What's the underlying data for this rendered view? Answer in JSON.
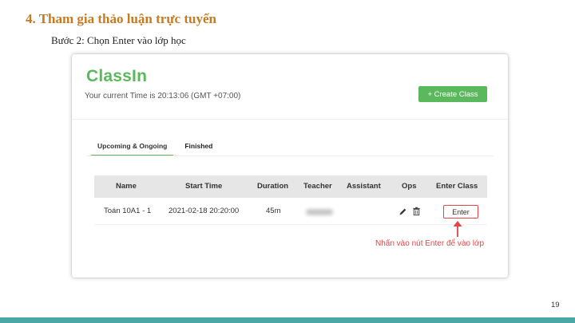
{
  "slide": {
    "title": "4. Tham gia thảo luận trực tuyến",
    "subtitle": "Bước 2: Chọn Enter vào lớp học",
    "page_number": "19"
  },
  "app": {
    "logo": "ClassIn",
    "current_time": "Your current Time is 20:13:06 (GMT +07:00)",
    "create_button": "+ Create Class",
    "accent_color": "#5cb85c"
  },
  "tabs": [
    {
      "label": "Upcoming & Ongoing",
      "active": true
    },
    {
      "label": "Finished",
      "active": false
    }
  ],
  "table": {
    "headers": [
      "Name",
      "Start Time",
      "Duration",
      "Teacher",
      "Assistant",
      "Ops",
      "Enter Class"
    ],
    "rows": [
      {
        "name": "Toán 10A1 - 1",
        "start_time": "2021-02-18 20:20:00",
        "duration": "45m",
        "teacher": "",
        "assistant": "",
        "ops_icons": [
          "pencil-icon",
          "trash-icon"
        ],
        "enter_label": "Enter"
      }
    ]
  },
  "annotation": {
    "text": "Nhấn vào nút Enter để vào lớp",
    "color": "#e24646"
  }
}
